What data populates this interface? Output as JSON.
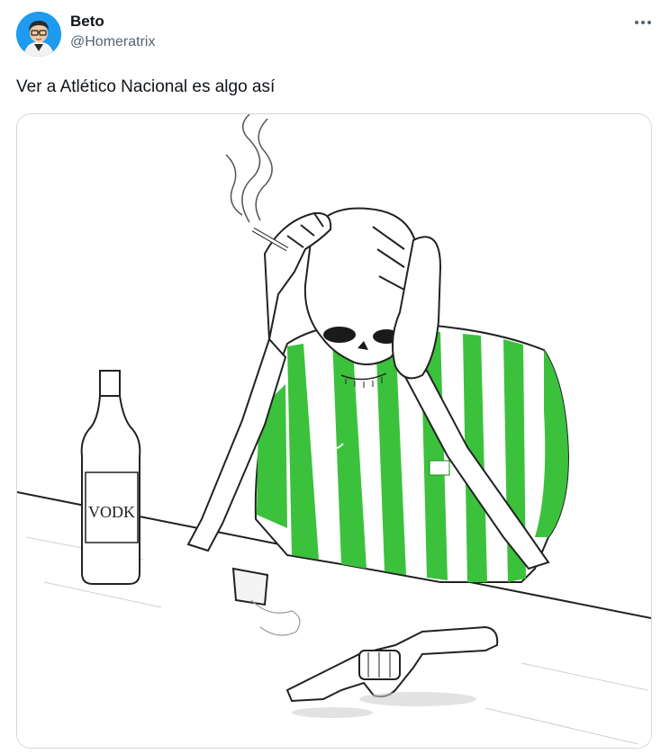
{
  "author": {
    "display_name": "Beto",
    "handle": "@Homeratrix"
  },
  "tweet": {
    "text": "Ver a Atlético Nacional es algo así"
  },
  "media": {
    "bottle_label": "VODK"
  },
  "icons": {
    "more": "more-horizontal-icon"
  },
  "colors": {
    "jersey_green": "#3cc13c",
    "name_text": "#0f1419",
    "handle_text": "#536471",
    "media_border": "#cfd9de"
  }
}
